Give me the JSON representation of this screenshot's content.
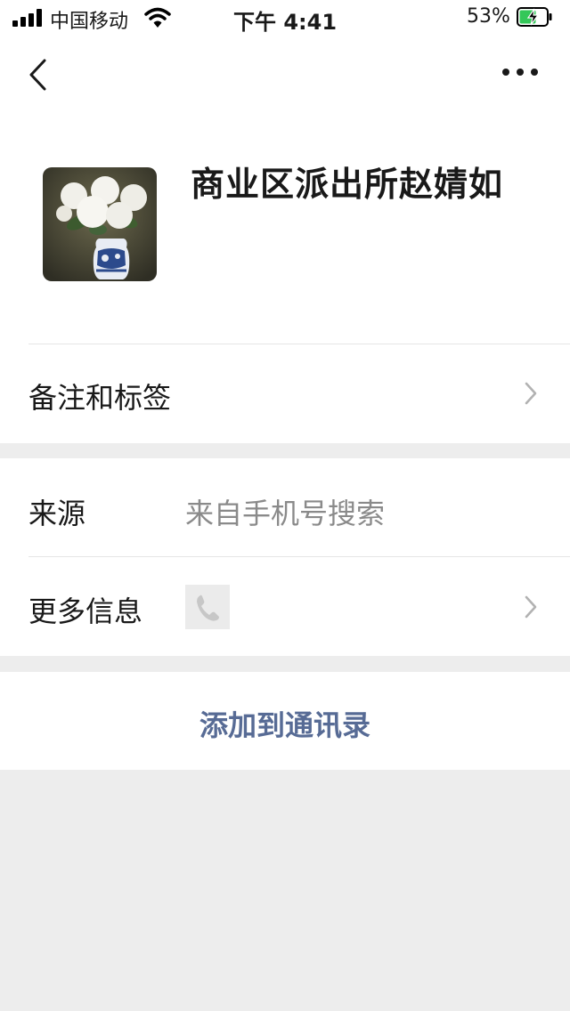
{
  "status_bar": {
    "carrier": "中国移动",
    "time": "下午 4:41",
    "battery_percent_text": "53%",
    "battery_level": 0.53
  },
  "contact": {
    "name": "商业区派出所赵婧如"
  },
  "rows": {
    "remarks_label": "备注和标签",
    "source_label": "来源",
    "source_value": "来自手机号搜索",
    "more_info_label": "更多信息"
  },
  "actions": {
    "add_to_contacts": "添加到通讯录"
  },
  "colors": {
    "link_blue": "#576b95",
    "background_gray": "#ededed",
    "battery_green": "#34c759"
  },
  "icons": [
    "signal-icon",
    "wifi-icon",
    "battery-icon",
    "back-icon",
    "more-icon",
    "chevron-right-icon",
    "phone-icon",
    "avatar-image"
  ]
}
